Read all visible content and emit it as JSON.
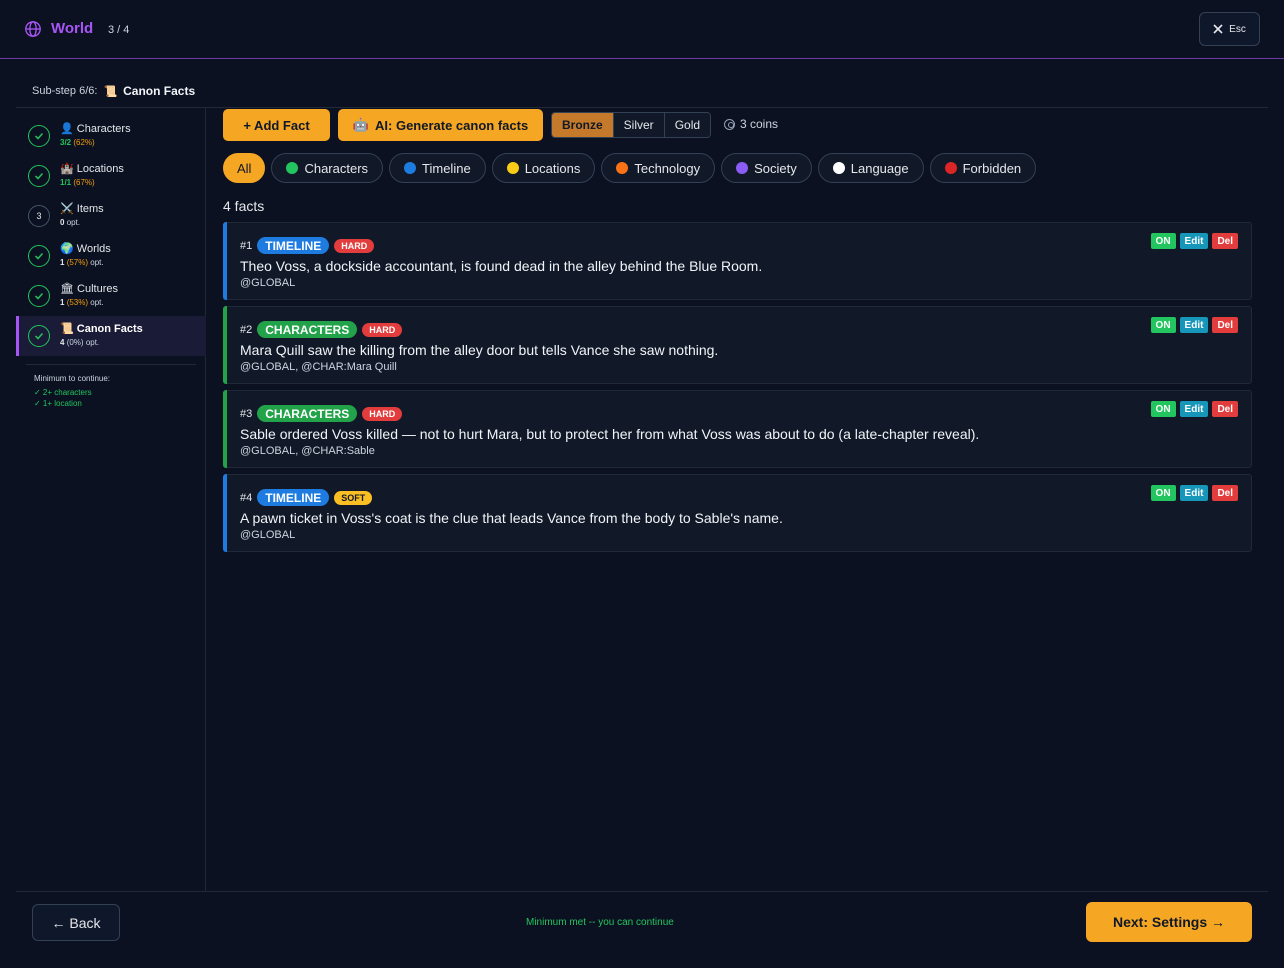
{
  "header": {
    "title": "World",
    "step": "3 / 4",
    "close_label": "Esc"
  },
  "substep": {
    "label": "Sub-step 6/6:",
    "icon": "📜",
    "title": "Canon Facts"
  },
  "sidebar": {
    "items": [
      {
        "icon": "👤",
        "label": "Characters",
        "count": "3/2",
        "pct": "(62%)",
        "suffix": ""
      },
      {
        "icon": "🏰",
        "label": "Locations",
        "count": "1/1",
        "pct": "(67%)",
        "suffix": ""
      },
      {
        "icon": "⚔️",
        "label": "Items",
        "count": "0",
        "pct": "",
        "suffix": "opt.",
        "number": "3"
      },
      {
        "icon": "🌍",
        "label": "Worlds",
        "count": "1",
        "pct": "(57%)",
        "suffix": "opt."
      },
      {
        "icon": "🏛",
        "label": "Cultures",
        "count": "1",
        "pct": "(53%)",
        "suffix": "opt."
      },
      {
        "icon": "📜",
        "label": "Canon Facts",
        "count": "4",
        "pct": "(0%)",
        "suffix": "opt."
      }
    ],
    "minimum_title": "Minimum to continue:",
    "minimum_items": [
      "✓ 2+ characters",
      "✓ 1+ location"
    ]
  },
  "toolbar": {
    "add_label": "+ Add Fact",
    "ai_icon": "🤖",
    "ai_label": "AI: Generate canon facts",
    "tiers": [
      "Bronze",
      "Silver",
      "Gold"
    ],
    "coins": "3 coins"
  },
  "filters": [
    {
      "label": "All"
    },
    {
      "label": "Characters",
      "color": "#22c55e"
    },
    {
      "label": "Timeline",
      "color": "#1e7be0"
    },
    {
      "label": "Locations",
      "color": "#facc15"
    },
    {
      "label": "Technology",
      "color": "#f97316"
    },
    {
      "label": "Society",
      "color": "#8b5cf6"
    },
    {
      "label": "Language",
      "color": "#ffffff"
    },
    {
      "label": "Forbidden",
      "color": "#dc2626"
    }
  ],
  "fact_count": "4 facts",
  "facts": [
    {
      "num": "#1",
      "category": "TIMELINE",
      "severity": "HARD",
      "text": "Theo Voss, a dockside accountant, is found dead in the alley behind the Blue Room.",
      "scope": "@GLOBAL"
    },
    {
      "num": "#2",
      "category": "CHARACTERS",
      "severity": "HARD",
      "text": "Mara Quill saw the killing from the alley door but tells Vance she saw nothing.",
      "scope": "@GLOBAL, @CHAR:Mara Quill"
    },
    {
      "num": "#3",
      "category": "CHARACTERS",
      "severity": "HARD",
      "text": "Sable ordered Voss killed — not to hurt Mara, but to protect her from what Voss was about to do (a late-chapter reveal).",
      "scope": "@GLOBAL, @CHAR:Sable"
    },
    {
      "num": "#4",
      "category": "TIMELINE",
      "severity": "SOFT",
      "text": "A pawn ticket in Voss's coat is the clue that leads Vance from the body to Sable's name.",
      "scope": "@GLOBAL"
    }
  ],
  "fact_actions": {
    "on": "ON",
    "edit": "Edit",
    "del": "Del"
  },
  "colors": {
    "accent": "#f5a623",
    "brand": "#a855f7",
    "timeline": "#1e7be0",
    "characters": "#22a34a"
  },
  "footer": {
    "back_label": "← Back",
    "status": "Minimum met -- you can continue",
    "next_label": "Next: Settings →"
  }
}
